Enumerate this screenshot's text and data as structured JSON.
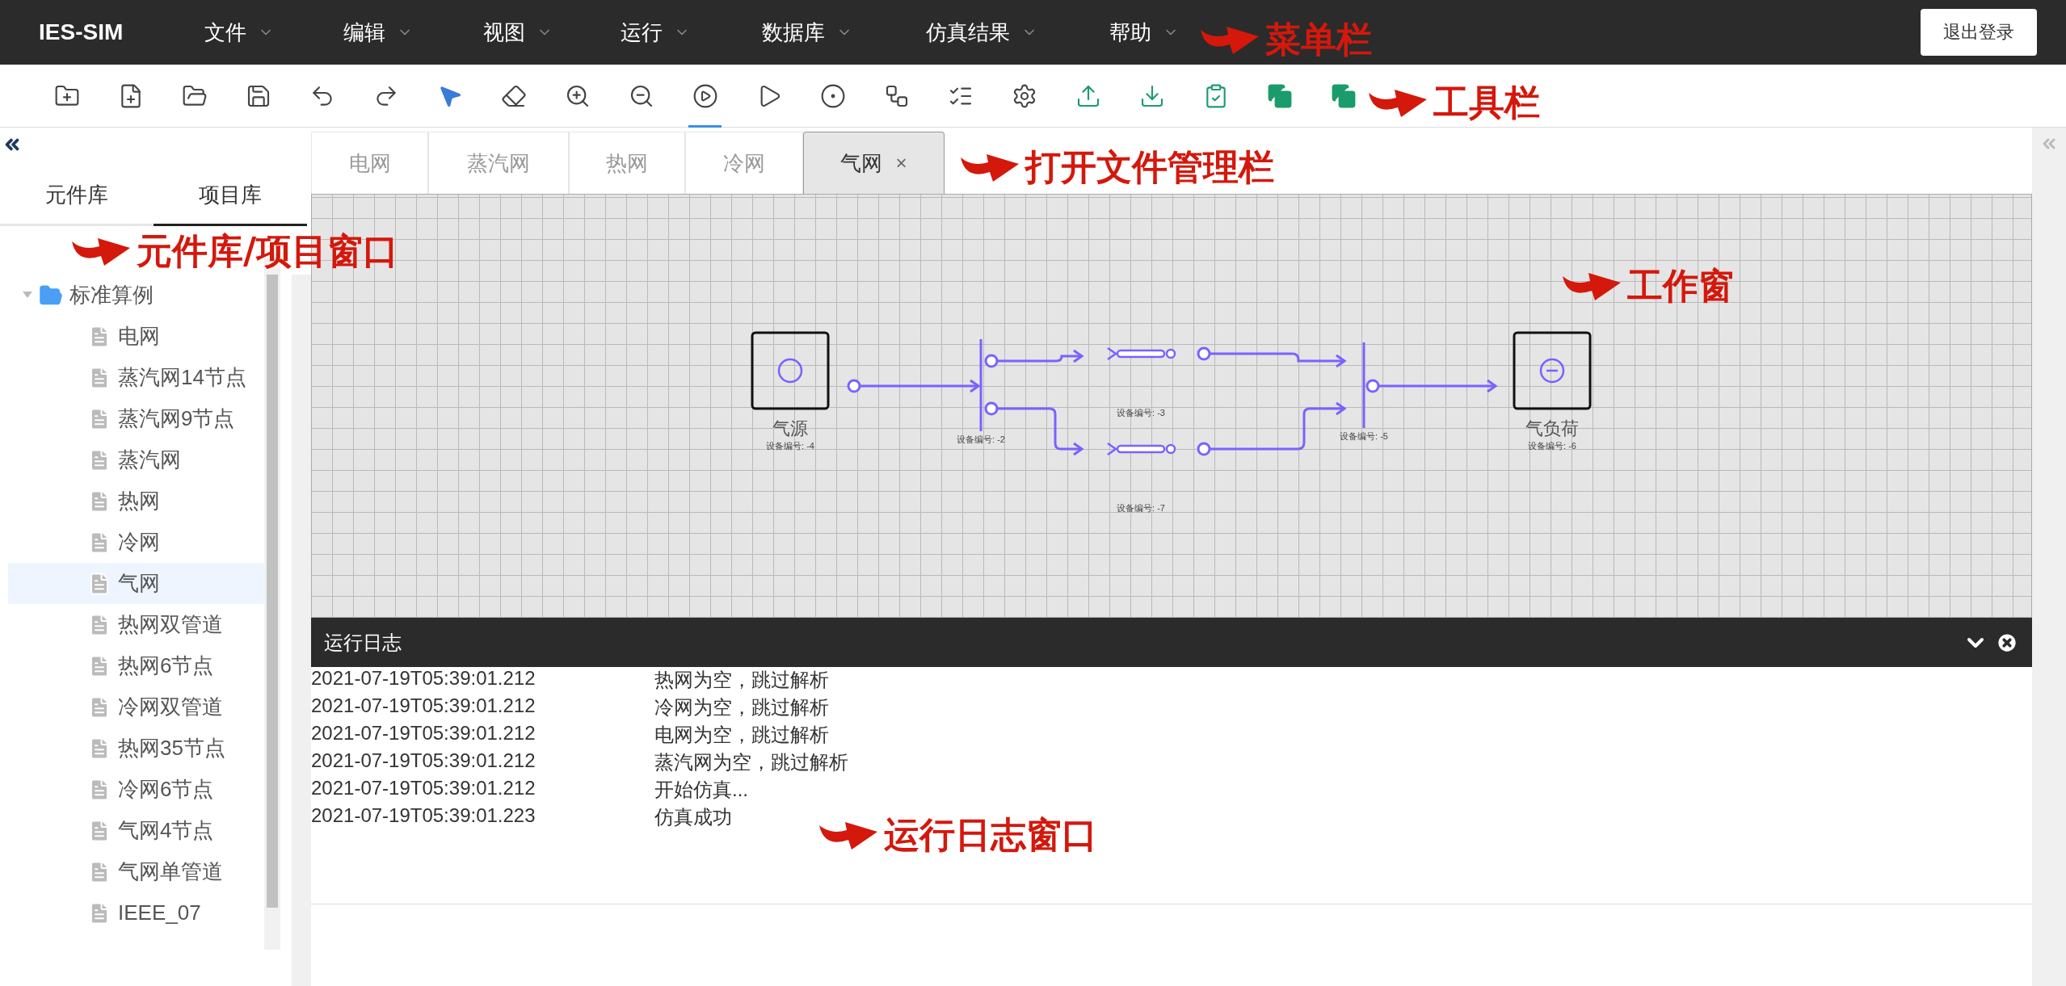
{
  "menu_bar": {
    "logo": "IES-SIM",
    "menus": [
      {
        "label": "文件"
      },
      {
        "label": "编辑"
      },
      {
        "label": "视图"
      },
      {
        "label": "运行"
      },
      {
        "label": "数据库"
      },
      {
        "label": "仿真结果"
      },
      {
        "label": "帮助"
      }
    ],
    "logout": "退出登录"
  },
  "toolbar": {
    "items": [
      {
        "selected": false
      },
      {
        "selected": false
      },
      {
        "selected": false
      },
      {
        "selected": false
      },
      {
        "selected": false
      },
      {
        "selected": false
      },
      {
        "selected": false
      },
      {
        "selected": false
      },
      {
        "selected": false
      },
      {
        "selected": false
      },
      {
        "selected": true
      },
      {
        "selected": false
      },
      {
        "selected": false
      },
      {
        "selected": false
      },
      {
        "selected": false
      },
      {
        "selected": false
      },
      {
        "selected": false
      },
      {
        "selected": false
      },
      {
        "selected": false
      },
      {
        "selected": false
      },
      {
        "selected": false
      }
    ]
  },
  "sidebar": {
    "tabs": [
      {
        "label": "元件库",
        "selected": false
      },
      {
        "label": "项目库",
        "selected": true
      }
    ],
    "tree": [
      {
        "label": "标准算例",
        "expanded": true,
        "selected": false,
        "children": [
          {
            "label": "电网",
            "selected": false
          },
          {
            "label": "蒸汽网14节点",
            "selected": false
          },
          {
            "label": "蒸汽网9节点",
            "selected": false
          },
          {
            "label": "蒸汽网",
            "selected": false
          },
          {
            "label": "热网",
            "selected": false
          },
          {
            "label": "冷网",
            "selected": false
          },
          {
            "label": "气网",
            "selected": true
          },
          {
            "label": "热网双管道",
            "selected": false
          },
          {
            "label": "热网6节点",
            "selected": false
          },
          {
            "label": "冷网双管道",
            "selected": false
          },
          {
            "label": "热网35节点",
            "selected": false
          },
          {
            "label": "冷网6节点",
            "selected": false
          },
          {
            "label": "气网4节点",
            "selected": false
          },
          {
            "label": "气网单管道",
            "selected": false
          },
          {
            "label": "IEEE_07",
            "selected": false
          }
        ]
      }
    ]
  },
  "file_tabs": [
    {
      "label": "电网",
      "selected": false,
      "closable": false
    },
    {
      "label": "蒸汽网",
      "selected": false,
      "closable": false
    },
    {
      "label": "热网",
      "selected": false,
      "closable": false
    },
    {
      "label": "冷网",
      "selected": false,
      "closable": false
    },
    {
      "label": "气网",
      "selected": true,
      "closable": true,
      "close": "×"
    }
  ],
  "canvas": {
    "nodes": [
      {
        "kind": "source",
        "label": "气源",
        "tag": "设备编号: -4"
      },
      {
        "kind": "junction",
        "tag": "设备编号: -2"
      },
      {
        "kind": "pipe",
        "tag": "设备编号: -3"
      },
      {
        "kind": "pipe",
        "tag": "设备编号: -7"
      },
      {
        "kind": "junction",
        "tag": "设备编号: -5"
      },
      {
        "kind": "load",
        "label": "气负荷",
        "tag": "设备编号: -6"
      }
    ]
  },
  "log": {
    "title": "运行日志",
    "entries": [
      {
        "time": "2021-07-19T05:39:01.212",
        "message": "热网为空，跳过解析"
      },
      {
        "time": "2021-07-19T05:39:01.212",
        "message": "冷网为空，跳过解析"
      },
      {
        "time": "2021-07-19T05:39:01.212",
        "message": "电网为空，跳过解析"
      },
      {
        "time": "2021-07-19T05:39:01.212",
        "message": "蒸汽网为空，跳过解析"
      },
      {
        "time": "2021-07-19T05:39:01.212",
        "message": "开始仿真..."
      },
      {
        "time": "2021-07-19T05:39:01.223",
        "message": "仿真成功"
      }
    ]
  },
  "annotations": [
    {
      "text": "菜单栏"
    },
    {
      "text": "工具栏"
    },
    {
      "text": "打开文件管理栏"
    },
    {
      "text": "元件库/项目窗口"
    },
    {
      "text": "工作窗"
    },
    {
      "text": "运行日志窗口"
    }
  ]
}
